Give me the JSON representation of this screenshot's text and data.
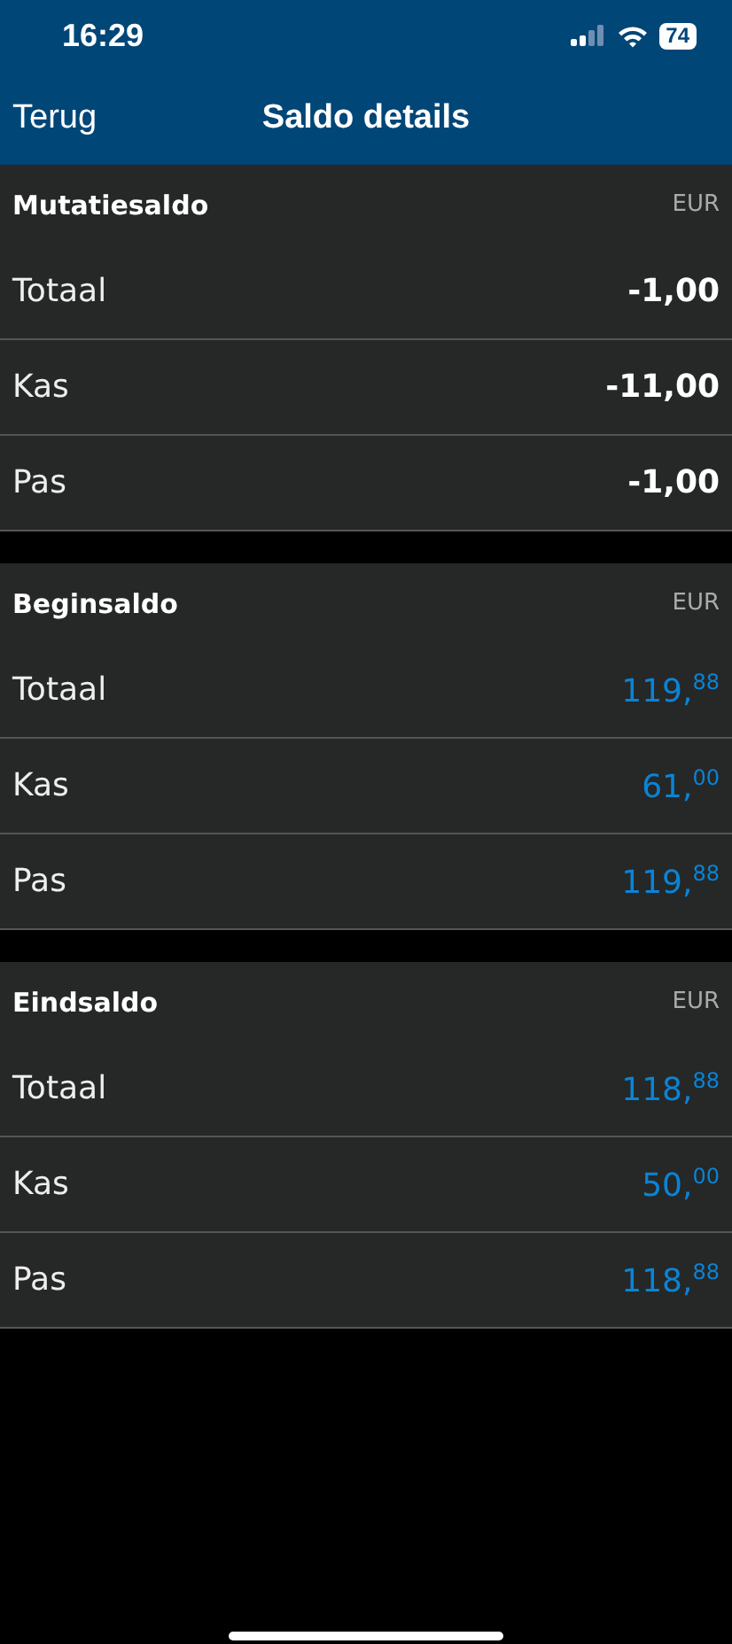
{
  "status_bar": {
    "time": "16:29",
    "battery": "74"
  },
  "nav": {
    "back": "Terug",
    "title": "Saldo details"
  },
  "sections": [
    {
      "title": "Mutatiesaldo",
      "currency": "EUR",
      "kind": "plain",
      "rows": [
        {
          "label": "Totaal",
          "amount": "-1,00"
        },
        {
          "label": "Kas",
          "amount": "-11,00"
        },
        {
          "label": "Pas",
          "amount": "-1,00"
        }
      ]
    },
    {
      "title": "Beginsaldo",
      "currency": "EUR",
      "kind": "accent",
      "rows": [
        {
          "label": "Totaal",
          "amount": "119,$^{88}$"
        },
        {
          "label": "Kas",
          "amount": "61,$^{00}$"
        },
        {
          "label": "Pas",
          "amount": "119,$^{88}$"
        }
      ]
    },
    {
      "title": "Eindsaldo",
      "currency": "EUR",
      "kind": "accent",
      "rows": [
        {
          "label": "Totaal",
          "amount": "118,$^{88}$"
        },
        {
          "label": "Kas",
          "amount": "50,$^{00}$"
        },
        {
          "label": "Pas",
          "amount": "118,$^{88}$"
        }
      ]
    }
  ]
}
